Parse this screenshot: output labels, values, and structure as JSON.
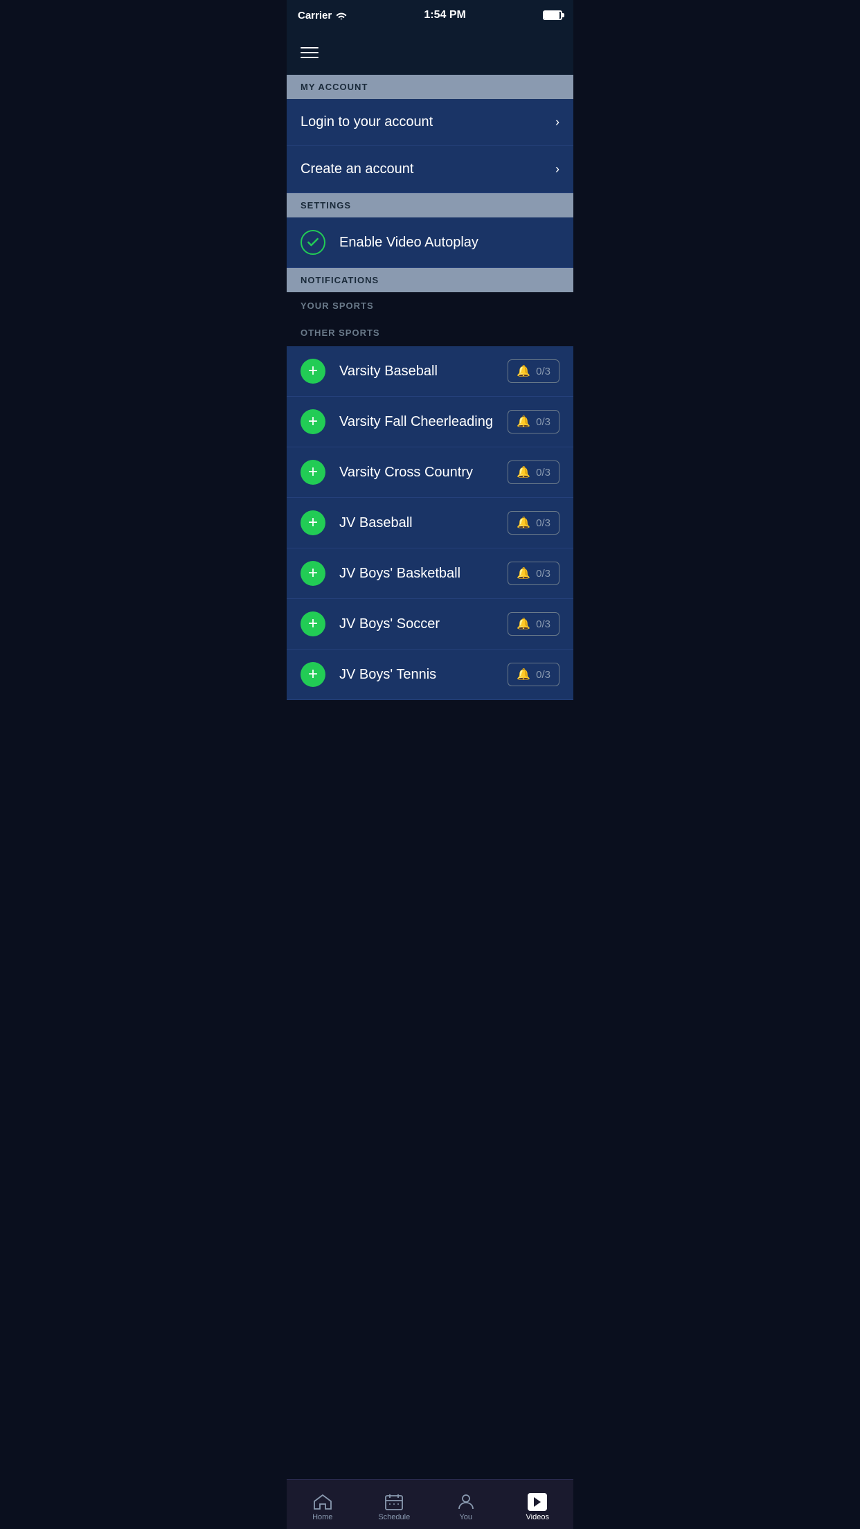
{
  "status_bar": {
    "carrier": "Carrier",
    "time": "1:54 PM"
  },
  "header": {
    "menu_icon_label": "Menu"
  },
  "sections": {
    "my_account": {
      "label": "MY ACCOUNT",
      "items": [
        {
          "text": "Login to your account",
          "id": "login"
        },
        {
          "text": "Create an account",
          "id": "create"
        }
      ]
    },
    "settings": {
      "label": "SETTINGS",
      "items": [
        {
          "text": "Enable Video Autoplay",
          "checked": true
        }
      ]
    },
    "notifications": {
      "label": "NOTIFICATIONS"
    },
    "your_sports": {
      "label": "YOUR SPORTS"
    },
    "other_sports": {
      "label": "OTHER SPORTS",
      "sports": [
        {
          "name": "Varsity Baseball",
          "notifications": "0/3"
        },
        {
          "name": "Varsity Fall Cheerleading",
          "notifications": "0/3"
        },
        {
          "name": "Varsity Cross Country",
          "notifications": "0/3"
        },
        {
          "name": "JV Baseball",
          "notifications": "0/3"
        },
        {
          "name": "JV Boys' Basketball",
          "notifications": "0/3"
        },
        {
          "name": "JV Boys' Soccer",
          "notifications": "0/3"
        },
        {
          "name": "JV Boys' Tennis",
          "notifications": "0/3"
        }
      ]
    }
  },
  "tab_bar": {
    "items": [
      {
        "label": "Home",
        "id": "home",
        "active": false
      },
      {
        "label": "Schedule",
        "id": "schedule",
        "active": false
      },
      {
        "label": "You",
        "id": "you",
        "active": false
      },
      {
        "label": "Videos",
        "id": "videos",
        "active": true
      }
    ]
  }
}
